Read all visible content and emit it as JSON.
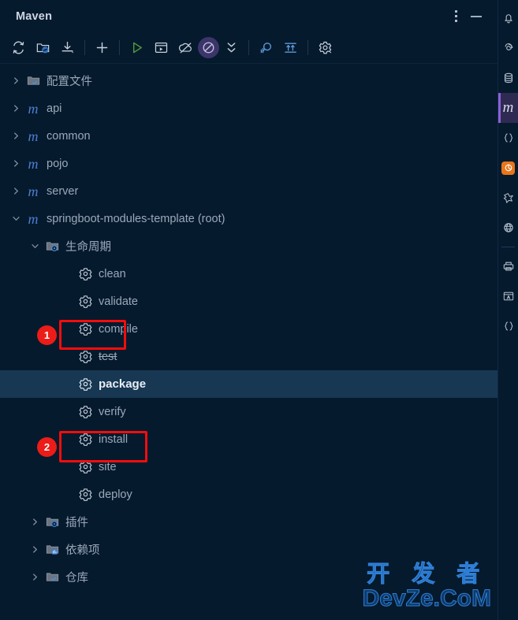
{
  "window": {
    "title": "Maven",
    "more_icon": "kebab-menu-icon",
    "minimize_icon": "minimize-icon"
  },
  "toolbar": {
    "items": [
      {
        "name": "reload-all-maven-projects-icon",
        "tooltip": "Reload All Maven Projects"
      },
      {
        "name": "add-maven-project-icon",
        "tooltip": "Add Maven Project"
      },
      {
        "name": "download-sources-icon",
        "tooltip": "Download Sources and Documentation"
      },
      {
        "name": "separator",
        "tooltip": ""
      },
      {
        "name": "plus-icon",
        "tooltip": "Add"
      },
      {
        "name": "separator",
        "tooltip": ""
      },
      {
        "name": "run-icon",
        "tooltip": "Run Maven Build"
      },
      {
        "name": "execute-maven-goal-icon",
        "tooltip": "Execute Maven Goal"
      },
      {
        "name": "toggle-offline-icon",
        "tooltip": "Toggle Offline Mode"
      },
      {
        "name": "skip-tests-icon",
        "tooltip": "Skip Tests"
      },
      {
        "name": "collapse-all-icon",
        "tooltip": "Collapse All"
      },
      {
        "name": "separator",
        "tooltip": ""
      },
      {
        "name": "profiler-icon",
        "tooltip": "Profiler"
      },
      {
        "name": "show-dependencies-icon",
        "tooltip": "Show Dependencies"
      },
      {
        "name": "separator",
        "tooltip": ""
      },
      {
        "name": "settings-gear-icon",
        "tooltip": "Maven Settings"
      }
    ]
  },
  "tree": {
    "nodes": [
      {
        "label": "配置文件",
        "icon": "folder-profiles-icon",
        "arrow": "chevron-right",
        "level": 0,
        "cjk": true,
        "expanded": false,
        "selected": false,
        "strike": false
      },
      {
        "label": "api",
        "icon": "maven-module-icon",
        "arrow": "chevron-right",
        "level": 0,
        "cjk": false,
        "expanded": false,
        "selected": false,
        "strike": false
      },
      {
        "label": "common",
        "icon": "maven-module-icon",
        "arrow": "chevron-right",
        "level": 0,
        "cjk": false,
        "expanded": false,
        "selected": false,
        "strike": false
      },
      {
        "label": "pojo",
        "icon": "maven-module-icon",
        "arrow": "chevron-right",
        "level": 0,
        "cjk": false,
        "expanded": false,
        "selected": false,
        "strike": false
      },
      {
        "label": "server",
        "icon": "maven-module-icon",
        "arrow": "chevron-right",
        "level": 0,
        "cjk": false,
        "expanded": false,
        "selected": false,
        "strike": false
      },
      {
        "label": "springboot-modules-template (root)",
        "icon": "maven-module-icon",
        "arrow": "chevron-down",
        "level": 0,
        "cjk": false,
        "expanded": true,
        "selected": false,
        "strike": false
      },
      {
        "label": "生命周期",
        "icon": "folder-lifecycle-icon",
        "arrow": "chevron-down",
        "level": 1,
        "cjk": true,
        "expanded": true,
        "selected": false,
        "strike": false
      },
      {
        "label": "clean",
        "icon": "maven-goal-icon",
        "arrow": "none",
        "level": 2,
        "cjk": false,
        "expanded": false,
        "selected": false,
        "strike": false
      },
      {
        "label": "validate",
        "icon": "maven-goal-icon",
        "arrow": "none",
        "level": 2,
        "cjk": false,
        "expanded": false,
        "selected": false,
        "strike": false
      },
      {
        "label": "compile",
        "icon": "maven-goal-icon",
        "arrow": "none",
        "level": 2,
        "cjk": false,
        "expanded": false,
        "selected": false,
        "strike": false
      },
      {
        "label": "test",
        "icon": "maven-goal-icon",
        "arrow": "none",
        "level": 2,
        "cjk": false,
        "expanded": false,
        "selected": false,
        "strike": true
      },
      {
        "label": "package",
        "icon": "maven-goal-icon",
        "arrow": "none",
        "level": 2,
        "cjk": false,
        "expanded": false,
        "selected": true,
        "strike": false
      },
      {
        "label": "verify",
        "icon": "maven-goal-icon",
        "arrow": "none",
        "level": 2,
        "cjk": false,
        "expanded": false,
        "selected": false,
        "strike": false
      },
      {
        "label": "install",
        "icon": "maven-goal-icon",
        "arrow": "none",
        "level": 2,
        "cjk": false,
        "expanded": false,
        "selected": false,
        "strike": false
      },
      {
        "label": "site",
        "icon": "maven-goal-icon",
        "arrow": "none",
        "level": 2,
        "cjk": false,
        "expanded": false,
        "selected": false,
        "strike": false
      },
      {
        "label": "deploy",
        "icon": "maven-goal-icon",
        "arrow": "none",
        "level": 2,
        "cjk": false,
        "expanded": false,
        "selected": false,
        "strike": false
      },
      {
        "label": "插件",
        "icon": "folder-plugins-icon",
        "arrow": "chevron-right",
        "level": 1,
        "cjk": true,
        "expanded": false,
        "selected": false,
        "strike": false
      },
      {
        "label": "依赖项",
        "icon": "folder-dependencies-icon",
        "arrow": "chevron-right",
        "level": 1,
        "cjk": true,
        "expanded": false,
        "selected": false,
        "strike": false
      },
      {
        "label": "仓库",
        "icon": "folder-repository-icon",
        "arrow": "chevron-right",
        "level": 1,
        "cjk": true,
        "expanded": false,
        "selected": false,
        "strike": false
      }
    ]
  },
  "annotations": [
    {
      "badge": "1",
      "target": "clean"
    },
    {
      "badge": "2",
      "target": "package"
    }
  ],
  "right_stripe": {
    "items": [
      {
        "name": "notifications-bell-icon",
        "selected": false
      },
      {
        "name": "spiral-icon",
        "selected": false
      },
      {
        "name": "database-icon",
        "selected": false
      },
      {
        "name": "maven-icon",
        "selected": true
      },
      {
        "name": "json-braces-icon",
        "selected": false
      },
      {
        "name": "orange-plugin-icon",
        "selected": false
      },
      {
        "name": "bird-icon",
        "selected": false
      },
      {
        "name": "globe-icon",
        "selected": false
      },
      {
        "name": "separator",
        "selected": false
      },
      {
        "name": "printer-icon",
        "selected": false
      },
      {
        "name": "translate-icon",
        "selected": false
      },
      {
        "name": "code-braces-icon",
        "selected": false
      }
    ]
  },
  "watermark": {
    "cjk": "开 发 者",
    "latin": "DevZe.CoM"
  },
  "colors": {
    "background": "#061a2d",
    "selection": "#173753",
    "annotation_red": "#ec1c18",
    "accent_purple": "#8a62d8",
    "text": "#9aa9bb"
  }
}
